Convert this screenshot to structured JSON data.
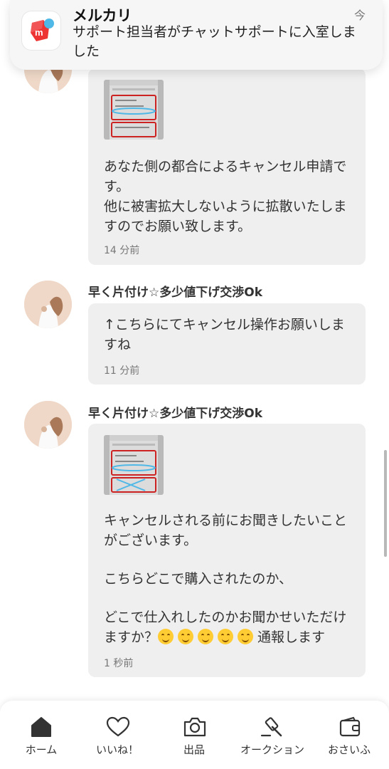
{
  "notification": {
    "app_name": "メルカリ",
    "time": "今",
    "message": "サポート担当者がチャットサポートに入室しました"
  },
  "messages": [
    {
      "sender": "",
      "text": "あなた側の都合によるキャンセル申請です。\n他に被害拡大しないように拡散いたしますのでお願い致します。",
      "time": "14 分前"
    },
    {
      "sender": "早く片付け☆多少値下げ交渉Ok",
      "text": "↑こちらにてキャンセル操作お願いしますね",
      "time": "11 分前"
    },
    {
      "sender": "早く片付け☆多少値下げ交渉Ok",
      "text_line1": "キャンセルされる前にお聞きしたいことがございます。",
      "text_line2": "こちらどこで購入されたのか、",
      "text_line3_a": "どこで仕入れしたのかお聞かせいただけますか？",
      "text_line3_b": "通報します",
      "time": "1 秒前"
    }
  ],
  "tabbar": {
    "items": [
      {
        "label": "ホーム",
        "icon": "home-icon"
      },
      {
        "label": "いいね！",
        "icon": "heart-icon"
      },
      {
        "label": "出品",
        "icon": "camera-icon"
      },
      {
        "label": "オークション",
        "icon": "gavel-icon"
      },
      {
        "label": "おさいふ",
        "icon": "wallet-icon"
      }
    ]
  },
  "colors": {
    "brand": "#ee3333",
    "bubble": "#efefef",
    "highlight": "#4fb8e6"
  }
}
